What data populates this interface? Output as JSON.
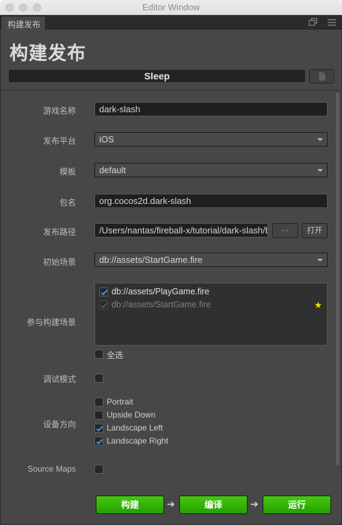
{
  "window": {
    "title": "Editor Window"
  },
  "tab": {
    "label": "构建发布"
  },
  "page": {
    "title": "构建发布"
  },
  "status": {
    "text": "Sleep"
  },
  "form": {
    "game_name": {
      "label": "游戏名称",
      "value": "dark-slash"
    },
    "platform": {
      "label": "发布平台",
      "value": "iOS"
    },
    "template": {
      "label": "模板",
      "value": "default"
    },
    "package_name": {
      "label": "包名",
      "value": "org.cocos2d.dark-slash"
    },
    "build_path": {
      "label": "发布路径",
      "value": "/Users/nantas/fireball-x/tutorial/dark-slash/bu",
      "browse_label": "···",
      "open_label": "打开"
    },
    "start_scene": {
      "label": "初始场景",
      "value": "db://assets/StartGame.fire"
    },
    "included_scenes": {
      "label": "参与构建场景",
      "items": [
        {
          "path": "db://assets/PlayGame.fire",
          "checked": true,
          "disabled": false
        },
        {
          "path": "db://assets/StartGame.fire",
          "checked": true,
          "disabled": true,
          "is_start": true
        }
      ],
      "select_all_label": "全选",
      "select_all_checked": false
    },
    "debug_mode": {
      "label": "调试模式",
      "checked": false
    },
    "orientation": {
      "label": "设备方向",
      "options": [
        {
          "label": "Portrait",
          "checked": false
        },
        {
          "label": "Upside Down",
          "checked": false
        },
        {
          "label": "Landscape Left",
          "checked": true
        },
        {
          "label": "Landscape Right",
          "checked": true
        }
      ]
    },
    "source_maps": {
      "label": "Source Maps",
      "checked": false
    }
  },
  "actions": {
    "build": "构建",
    "compile": "编译",
    "run": "运行",
    "arrow": "➔"
  },
  "colors": {
    "accent_check": "#3d9cf0",
    "action_green": "#3bbf0a",
    "star": "#f3e600"
  }
}
